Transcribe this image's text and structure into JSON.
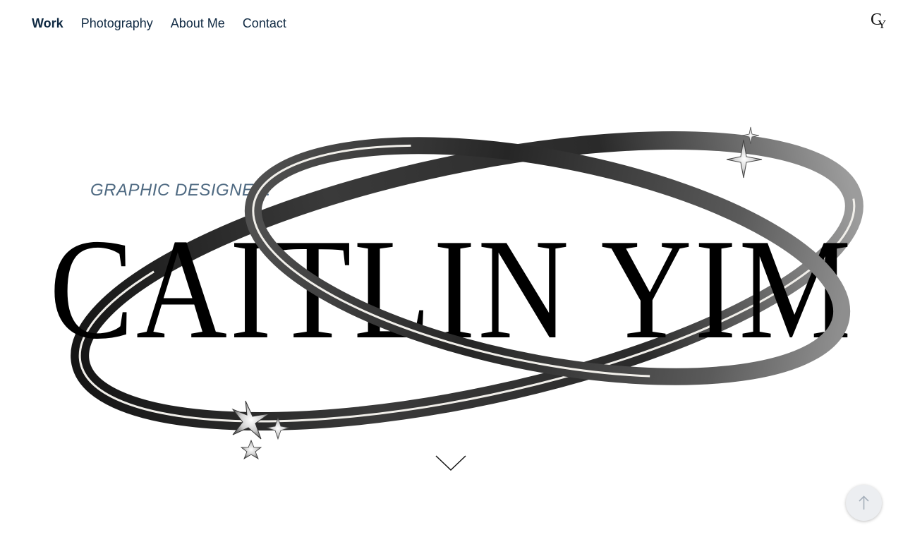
{
  "nav": {
    "items": [
      {
        "label": "Work",
        "active": true
      },
      {
        "label": "Photography",
        "active": false
      },
      {
        "label": "About Me",
        "active": false
      },
      {
        "label": "Contact",
        "active": false
      }
    ]
  },
  "logo": {
    "c": "C",
    "y": "Y"
  },
  "hero": {
    "subtitle": "GRAPHIC DESIGNER!",
    "name": "CAITLIN YIM"
  },
  "icons": {
    "scroll_down": "chevron-down-icon",
    "back_to_top": "arrow-up-icon",
    "sparkle": "sparkle-star-icon"
  },
  "colors": {
    "nav_text": "#102a43",
    "subtitle": "#4f6a82",
    "title": "#000000",
    "ribbon_dark": "#1e1e1e",
    "ribbon_light": "#9a9a9a",
    "ribbon_edge": "#f1efea",
    "button_bg": "#eceef1",
    "button_icon": "#a6b0bb"
  }
}
